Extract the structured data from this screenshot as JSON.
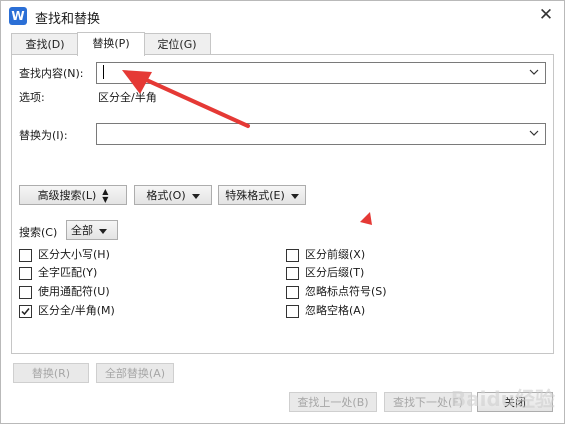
{
  "window": {
    "title": "查找和替换",
    "app_icon_letter": "W",
    "close_glyph": "✕"
  },
  "tabs": [
    {
      "label": "查找(D)",
      "active": false
    },
    {
      "label": "替换(P)",
      "active": true
    },
    {
      "label": "定位(G)",
      "active": false
    }
  ],
  "find": {
    "label": "查找内容(N):",
    "value": ""
  },
  "options": {
    "label": "选项:",
    "value": "区分全/半角"
  },
  "replace": {
    "label": "替换为(I):",
    "value": ""
  },
  "buttons": {
    "advanced": "高级搜索(L)",
    "format": "格式(O)",
    "special": "特殊格式(E)",
    "replace": "替换(R)",
    "replace_all": "全部替换(A)",
    "find_prev": "查找上一处(B)",
    "find_next": "查找下一处(F)",
    "close": "关闭"
  },
  "search": {
    "label": "搜索(C)",
    "value": "全部"
  },
  "checkboxes_left": [
    {
      "label": "区分大小写(H)",
      "checked": false
    },
    {
      "label": "全字匹配(Y)",
      "checked": false
    },
    {
      "label": "使用通配符(U)",
      "checked": false
    },
    {
      "label": "区分全/半角(M)",
      "checked": true
    }
  ],
  "checkboxes_right": [
    {
      "label": "区分前缀(X)",
      "checked": false
    },
    {
      "label": "区分后缀(T)",
      "checked": false
    },
    {
      "label": "忽略标点符号(S)",
      "checked": false
    },
    {
      "label": "忽略空格(A)",
      "checked": false
    }
  ],
  "colors": {
    "accent_arrow": "#e53935",
    "app_icon": "#2b6fd6"
  },
  "watermark": "Baidu经验"
}
